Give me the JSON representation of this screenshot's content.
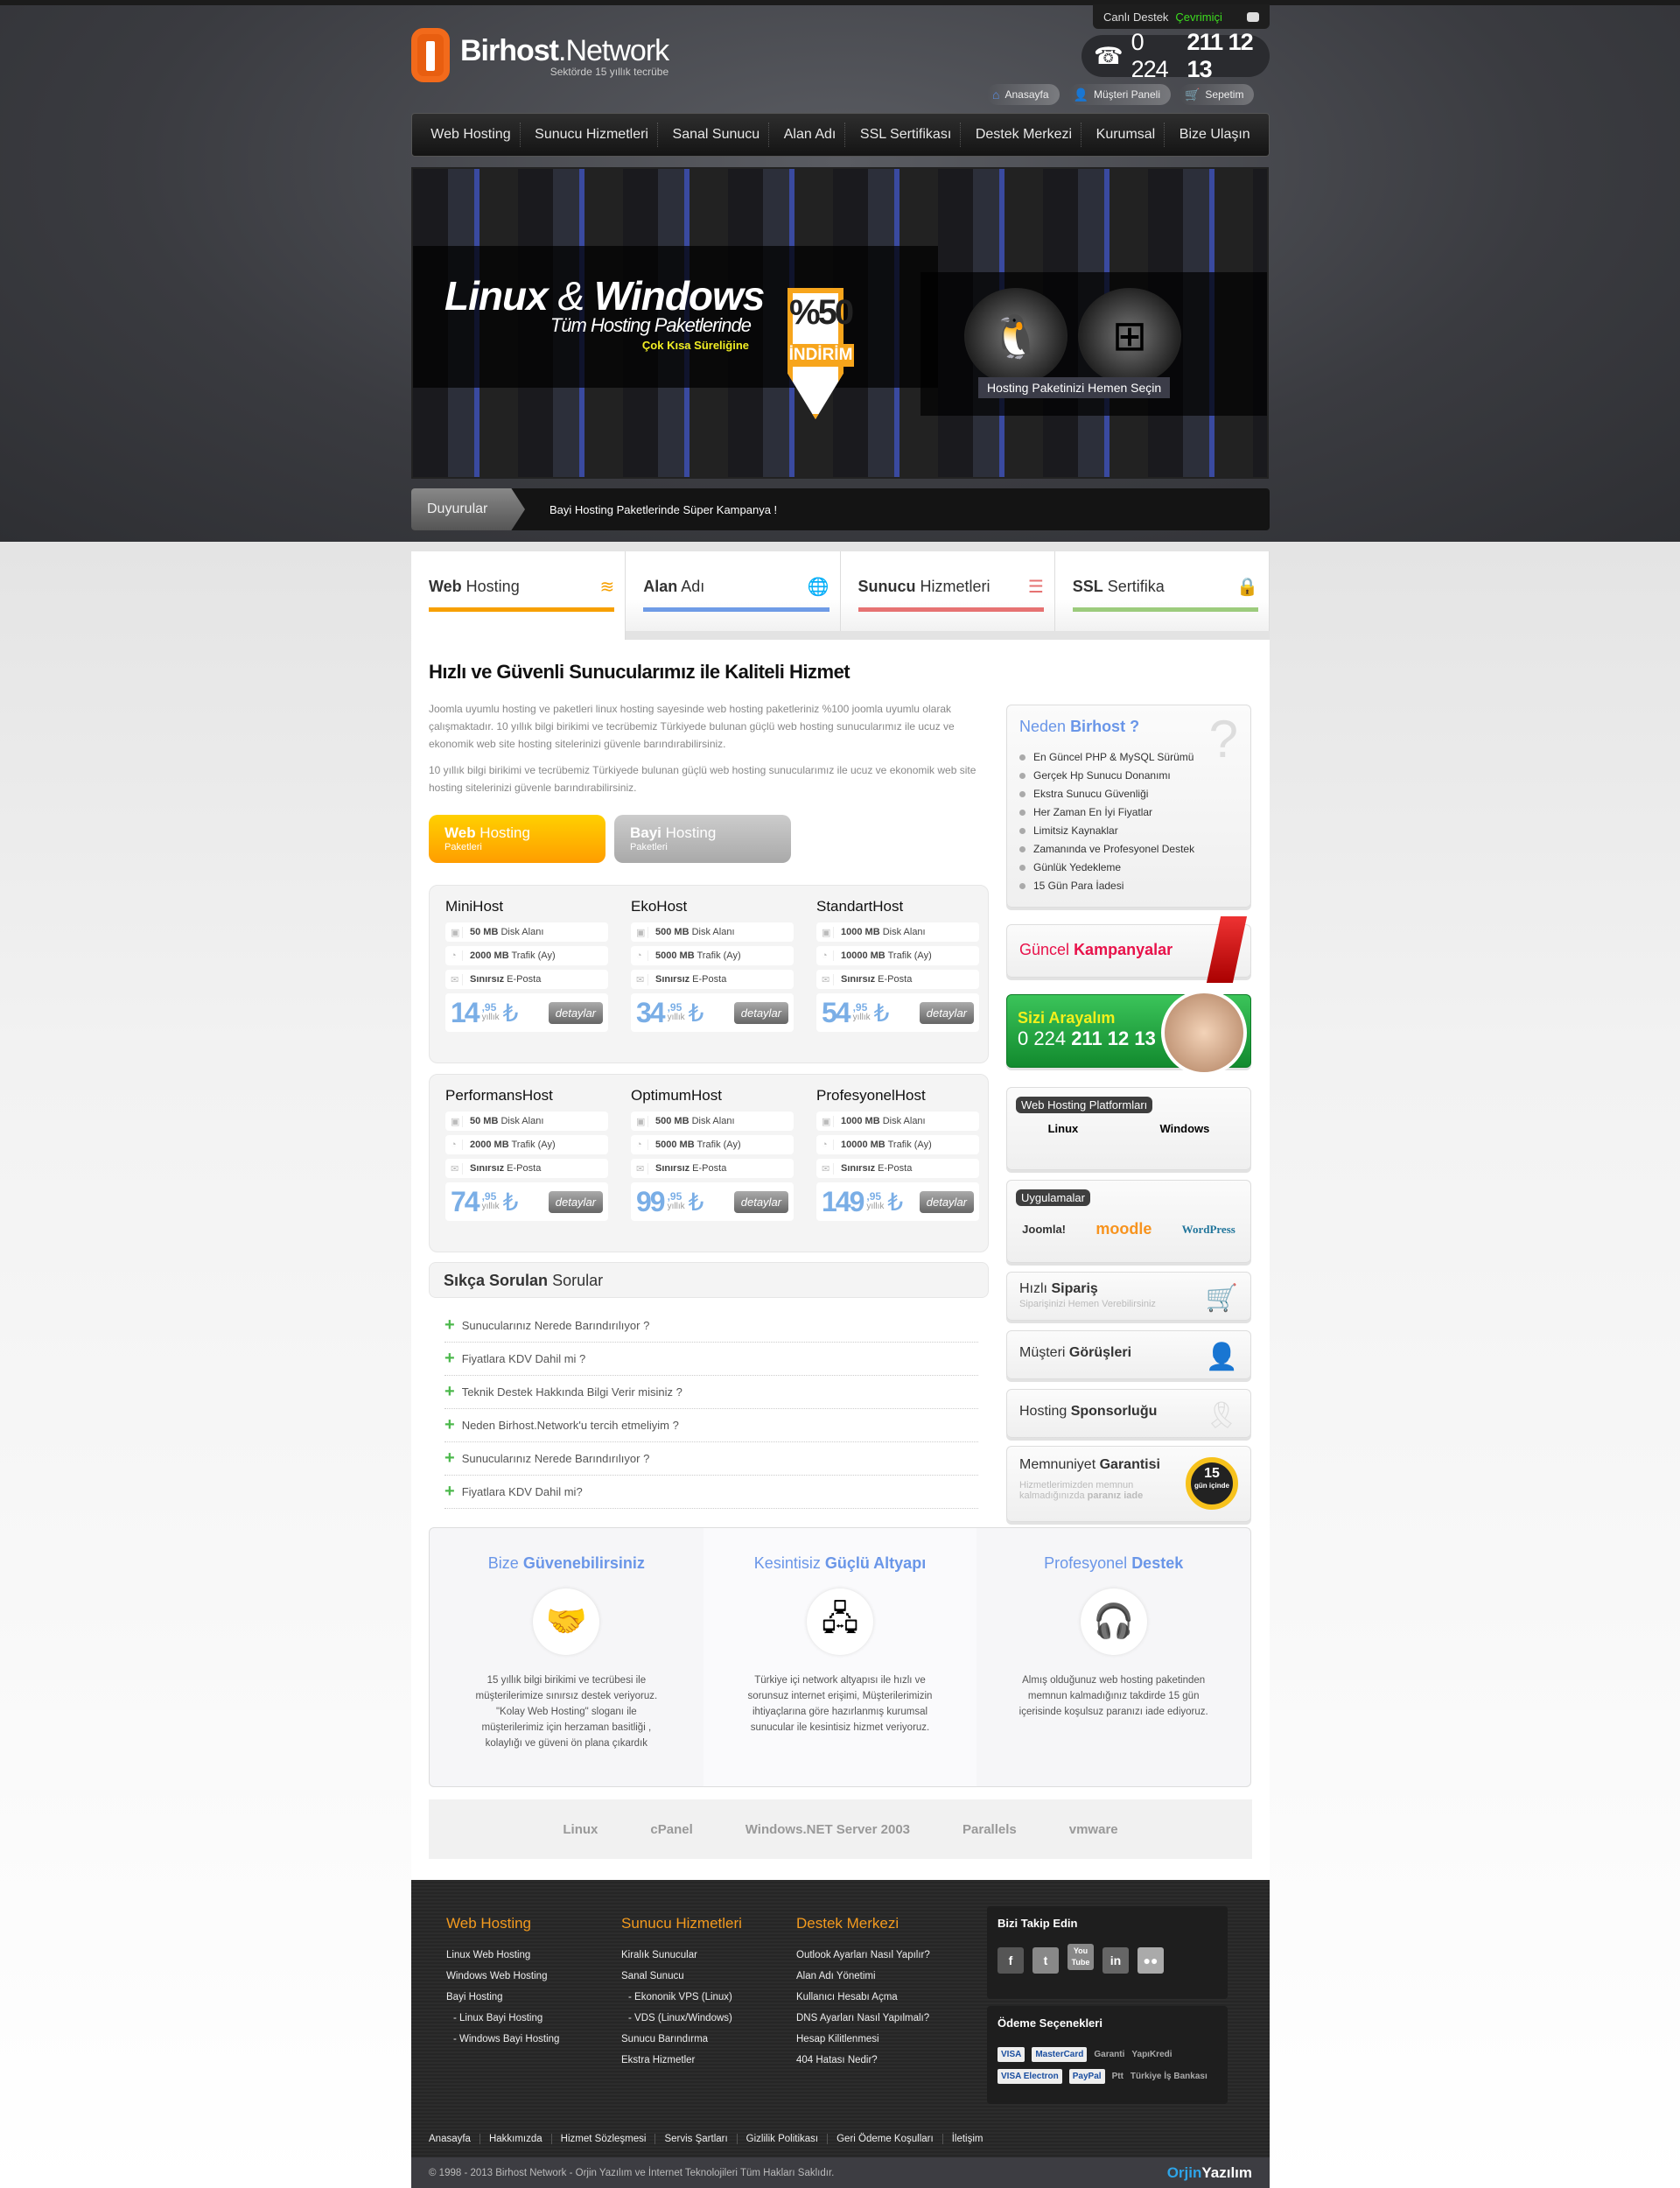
{
  "header": {
    "live_label": "Canlı Destek",
    "live_status": "Çevrimiçi",
    "logo_bold": "Birhost",
    "logo_rest": ".Network",
    "tagline": "Sektörde 15 yıllık tecrübe",
    "phone_prefix": "0 224",
    "phone_main": "211 12 13",
    "quick_links": [
      {
        "icon": "home-icon",
        "label": "Anasayfa"
      },
      {
        "icon": "user-icon",
        "label": "Müşteri Paneli"
      },
      {
        "icon": "cart-icon",
        "label": "Sepetim"
      }
    ]
  },
  "nav": [
    "Web Hosting",
    "Sunucu Hizmetleri",
    "Sanal Sunucu",
    "Alan Adı",
    "SSL Sertifikası",
    "Destek Merkezi",
    "Kurumsal",
    "Bize Ulaşın"
  ],
  "hero": {
    "title_a": "Linux",
    "title_amp": "&",
    "title_b": "Windows",
    "subtitle": "Tüm Hosting Paketlerinde",
    "note": "Çok Kısa Süreliğine",
    "discount": "%50",
    "discount_label": "İNDİRİM",
    "cta": "Hosting Paketinizi Hemen Seçin"
  },
  "announcement": {
    "label": "Duyurular",
    "text": "Bayi Hosting Paketlerinde Süper Kampanya !"
  },
  "tabs": [
    {
      "bold": "Web",
      "rest": " Hosting",
      "color": "#f7a000",
      "icon": "layers-icon"
    },
    {
      "bold": "Alan",
      "rest": " Adı",
      "color": "#6e9be6",
      "icon": "globe-icon"
    },
    {
      "bold": "Sunucu",
      "rest": " Hizmetleri",
      "color": "#e67272",
      "icon": "server-icon"
    },
    {
      "bold": "SSL",
      "rest": " Sertifika",
      "color": "#9ccb7c",
      "icon": "lock-icon"
    }
  ],
  "content": {
    "heading": "Hızlı ve Güvenli Sunucularımız ile Kaliteli Hizmet",
    "para1": "Joomla uyumlu hosting ve paketleri linux hosting sayesinde web hosting paketleriniz %100 joomla uyumlu olarak çalışmaktadır. 10 yıllık bilgi birikimi ve tecrübemiz Türkiyede bulunan güçlü web hosting sunucularımız ile ucuz ve ekonomik web site hosting sitelerinizi güvenle barındırabilirsiniz.",
    "para2": "10 yıllık bilgi birikimi ve tecrübemiz Türkiyede bulunan güçlü web hosting sunucularımız ile ucuz ve ekonomik web site hosting sitelerinizi güvenle barındırabilirsiniz."
  },
  "package_buttons": [
    {
      "bold": "Web",
      "rest": " Hosting",
      "sub": "Paketleri"
    },
    {
      "bold": "Bayi",
      "rest": " Hosting",
      "sub": "Paketleri"
    }
  ],
  "packages": [
    {
      "a": "Mini",
      "b": "Host",
      "disk": "50 MB",
      "traffic": "2000 MB",
      "email": "Sınırsız",
      "price": "14",
      "cents": ",95"
    },
    {
      "a": "Eko",
      "b": "Host",
      "disk": "500 MB",
      "traffic": "5000 MB",
      "email": "Sınırsız",
      "price": "34",
      "cents": ",95"
    },
    {
      "a": "Standart",
      "b": "Host",
      "disk": "1000 MB",
      "traffic": "10000 MB",
      "email": "Sınırsız",
      "price": "54",
      "cents": ",95"
    },
    {
      "a": "Performans",
      "b": "Host",
      "disk": "50 MB",
      "traffic": "2000 MB",
      "email": "Sınırsız",
      "price": "74",
      "cents": ",95"
    },
    {
      "a": "Optimum",
      "b": "Host",
      "disk": "500 MB",
      "traffic": "5000 MB",
      "email": "Sınırsız",
      "price": "99",
      "cents": ",95"
    },
    {
      "a": "Profesyonel",
      "b": "Host",
      "disk": "1000 MB",
      "traffic": "10000 MB",
      "email": "Sınırsız",
      "price": "149",
      "cents": ",95"
    }
  ],
  "package_labels": {
    "disk": " Disk Alanı",
    "traffic": " Trafik (Ay)",
    "email": " E-Posta",
    "period": "yıllık",
    "currency": "₺",
    "details": "detaylar"
  },
  "faq": {
    "title_bold": "Sıkça Sorulan",
    "title_rest": " Sorular",
    "items": [
      "Sunucularınız Nerede Barındırılıyor ?",
      "Fiyatlara KDV Dahil mi ?",
      "Teknik Destek Hakkında Bilgi Verir misiniz ?",
      "Neden Birhost.Network'u tercih etmeliyim ?",
      "Sunucularınız Nerede Barındırılıyor ?",
      "Fiyatlara KDV Dahil mi?"
    ]
  },
  "sidebar": {
    "why_a": "Neden",
    "why_b": "Birhost ?",
    "why_items": [
      "En Güncel PHP & MySQL Sürümü",
      "Gerçek Hp Sunucu Donanımı",
      "Ekstra Sunucu Güvenliği",
      "Her Zaman En İyi Fiyatlar",
      "Limitsiz Kaynaklar",
      "Zamanında ve Profesyonel Destek",
      "Günlük Yedekleme",
      "15 Gün Para İadesi"
    ],
    "campaign_a": "Güncel",
    "campaign_b": "Kampanyalar",
    "callback_title": "Sizi Arayalım",
    "callback_prefix": "0 224",
    "callback_main": "211 12 13",
    "platforms_title": "Web Hosting Platformları",
    "platforms": [
      "Linux",
      "Windows"
    ],
    "apps_title": "Uygulamalar",
    "apps": [
      "Joomla!",
      "moodle",
      "WordPress"
    ],
    "order_a": "Hızlı",
    "order_b": "Sipariş",
    "order_sub": "Siparişinizi Hemen Verebilirsiniz",
    "reviews_a": "Müşteri",
    "reviews_b": "Görüşleri",
    "sponsor_a": "Hosting",
    "sponsor_b": "Sponsorluğu",
    "guarantee_a": "Memnuniyet",
    "guarantee_b": "Garantisi",
    "guarantee_sub": "Hizmetlerimizden memnun kalmadığınızda",
    "guarantee_sub_bold": "paranız iade",
    "badge_num": "15",
    "badge_txt": "gün içinde"
  },
  "features": [
    {
      "a": "Bize",
      "b": "Güvenebilirsiniz",
      "icon": "handshake-icon",
      "text": "15 yıllık bilgi birikimi ve tecrübesi ile müşterilerimize sınırsız destek veriyoruz. \"Kolay Web Hosting\" sloganı ile müşterilerimiz için herzaman basitliği , kolaylığı ve güveni ön plana çıkardık"
    },
    {
      "a": "Kesintisiz",
      "b": "Güçlü Altyapı",
      "icon": "network-icon",
      "text": "Türkiye içi network altyapısı ile hızlı ve sorunsuz internet erişimi, Müşterilerimizin ihtiyaçlarına göre hazırlanmış kurumsal sunucular ile kesintisiz hizmet veriyoruz."
    },
    {
      "a": "Profesyonel",
      "b": "Destek",
      "icon": "support-agent-icon",
      "text": "Almış olduğunuz web hosting paketinden memnun kalmadığınız takdirde 15 gün içerisinde koşulsuz paranızı iade ediyoruz."
    }
  ],
  "brands": [
    "Linux",
    "cPanel",
    "Windows.NET Server 2003",
    "Parallels",
    "vmware"
  ],
  "footer": {
    "columns": [
      {
        "title": "Web Hosting",
        "links": [
          "Linux Web Hosting",
          "Windows Web Hosting",
          "Bayi Hosting",
          "- Linux Bayi Hosting",
          "- Windows Bayi Hosting"
        ]
      },
      {
        "title": "Sunucu Hizmetleri",
        "links": [
          "Kiralık Sunucular",
          "Sanal Sunucu",
          "- Ekononik VPS (Linux)",
          "- VDS (Linux/Windows)",
          "Sunucu Barındırma",
          "Ekstra Hizmetler"
        ]
      },
      {
        "title": "Destek Merkezi",
        "links": [
          "Outlook Ayarları Nasıl Yapılır?",
          "Alan Adı Yönetimi",
          "Kullanıcı Hesabı Açma",
          "DNS Ayarları Nasıl Yapılmalı?",
          "Hesap Kilitlenmesi",
          "404 Hatası Nedir?"
        ]
      }
    ],
    "follow_title": "Bizi Takip Edin",
    "social": [
      "facebook",
      "twitter",
      "youtube",
      "linkedin",
      "flickr"
    ],
    "payment_title": "Ödeme Seçenekleri",
    "payments": [
      "VISA",
      "MasterCard",
      "Garanti",
      "YapıKredi",
      "VISA Electron",
      "PayPal",
      "Ptt",
      "Türkiye İş Bankası"
    ],
    "bottom_links": [
      "Anasayfa",
      "Hakkımızda",
      "Hizmet Sözleşmesi",
      "Servis Şartları",
      "Gizlilik Politikası",
      "Geri Ödeme Koşulları",
      "İletişim"
    ],
    "copyright": "© 1998 - 2013 Birhost Network - Orjin Yazılım ve İnternet Teknolojileri Tüm Hakları Saklıdır.",
    "brand_a": "Orjin",
    "brand_b": "Yazılım"
  }
}
